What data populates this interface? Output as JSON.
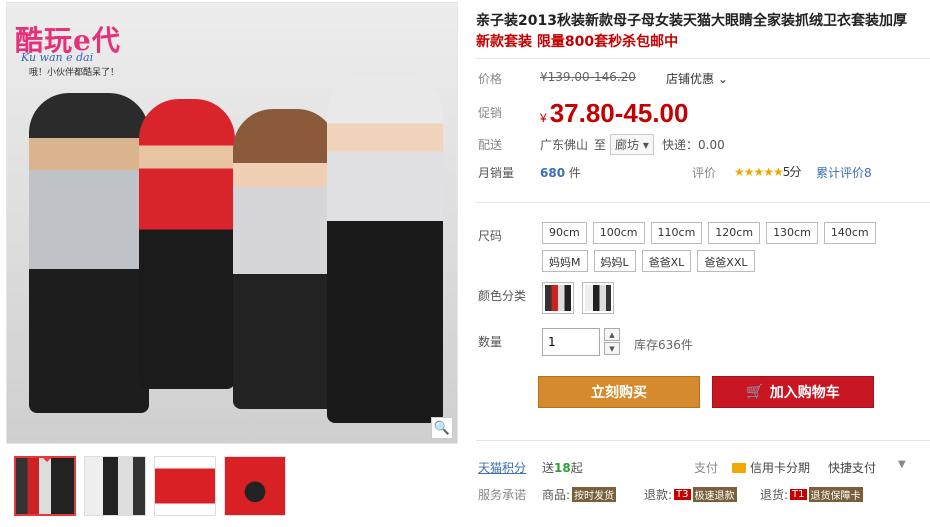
{
  "logo": {
    "text": "酷玩e代",
    "pinyin": "Ku wan e dai",
    "slogan": "哦！小伙伴都酷呆了！"
  },
  "product": {
    "title": "亲子装2013秋装新款母子母女装天猫大眼睛全家装抓绒卫衣套装加厚",
    "subtitle": "新款套装 限量800套秒杀包邮中"
  },
  "price": {
    "label": "价格",
    "original": "¥139.00-146.20",
    "shop_promo": "店铺优惠",
    "promo_label": "促销",
    "currency": "¥",
    "promo": "37.80-45.00"
  },
  "shipping": {
    "label": "配送",
    "from": "广东佛山",
    "to_word": "至",
    "city": "廊坊",
    "fee": "快递：0.00"
  },
  "sales": {
    "label": "月销量",
    "count": "680",
    "unit": "件",
    "rating_label": "评价",
    "stars": "★★★★★",
    "score": "5分",
    "reviews": "累计评价8"
  },
  "options": {
    "size_label": "尺码",
    "sizes": [
      "90cm",
      "100cm",
      "110cm",
      "120cm",
      "130cm",
      "140cm",
      "妈妈M",
      "妈妈L",
      "爸爸XL",
      "爸爸XXL"
    ],
    "color_label": "颜色分类"
  },
  "quantity": {
    "label": "数量",
    "value": "1",
    "stock": "库存636件"
  },
  "buttons": {
    "buy": "立刻购买",
    "cart": "加入购物车"
  },
  "footer": {
    "jifen_label": "天猫积分",
    "jifen_prefix": "送",
    "jifen_points": "18",
    "jifen_suffix": "起",
    "pay_label": "支付",
    "credit": "信用卡分期",
    "fast_pay": "快捷支付",
    "promise_label": "服务承诺",
    "goods_label": "商品:",
    "goods_tag": "按时发货",
    "refund_label": "退款:",
    "refund_code": "T3",
    "refund_tag": "极速退款",
    "return_label": "退货:",
    "return_code": "T1",
    "return_tag": "退货保障卡"
  },
  "colors": {
    "accent": "#c40000",
    "buy": "#d58a2d",
    "cart": "#c81623",
    "link": "#3c6fb6"
  }
}
